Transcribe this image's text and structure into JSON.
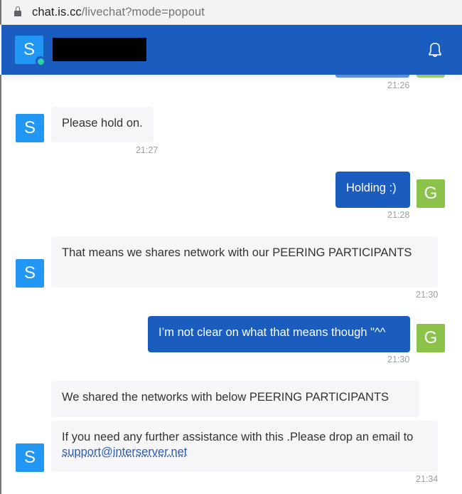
{
  "browser": {
    "url_host": "chat.is.cc",
    "url_path": "/livechat?mode=popout"
  },
  "header": {
    "agent_initial": "S",
    "agent_name": "[redacted]",
    "status": "online",
    "colors": {
      "header_bg": "#1b5cbf",
      "status_online": "#2ed3a3"
    }
  },
  "colors": {
    "agent_avatar": "#2196f3",
    "guest_avatar": "#8bc34a",
    "guest_bubble": "#1b5cbf",
    "agent_bubble": "#f6f6f9"
  },
  "messages": [
    {
      "sender": "guest",
      "initial": "G",
      "text": "",
      "time": "21:26",
      "partially_visible": true
    },
    {
      "sender": "agent",
      "initial": "S",
      "text": "Please hold on.",
      "time": "21:27"
    },
    {
      "sender": "guest",
      "initial": "G",
      "text": "Holding :)",
      "time": "21:28"
    },
    {
      "sender": "agent",
      "initial": "S",
      "text": "That means we shares network with our PEERING PARTICIPANTS",
      "time": "21:30"
    },
    {
      "sender": "guest",
      "initial": "G",
      "text": "I’m not clear on what that means though \"^^",
      "time": "21:30"
    },
    {
      "sender": "agent",
      "initial": "S",
      "text": "We shared the networks with below PEERING PARTICIPANTS",
      "time": ""
    },
    {
      "sender": "agent",
      "initial": "S",
      "text_prefix": "If you need any further assistance with this .Please drop an email to ",
      "link": "support@interserver.net",
      "time": "21:34"
    }
  ]
}
